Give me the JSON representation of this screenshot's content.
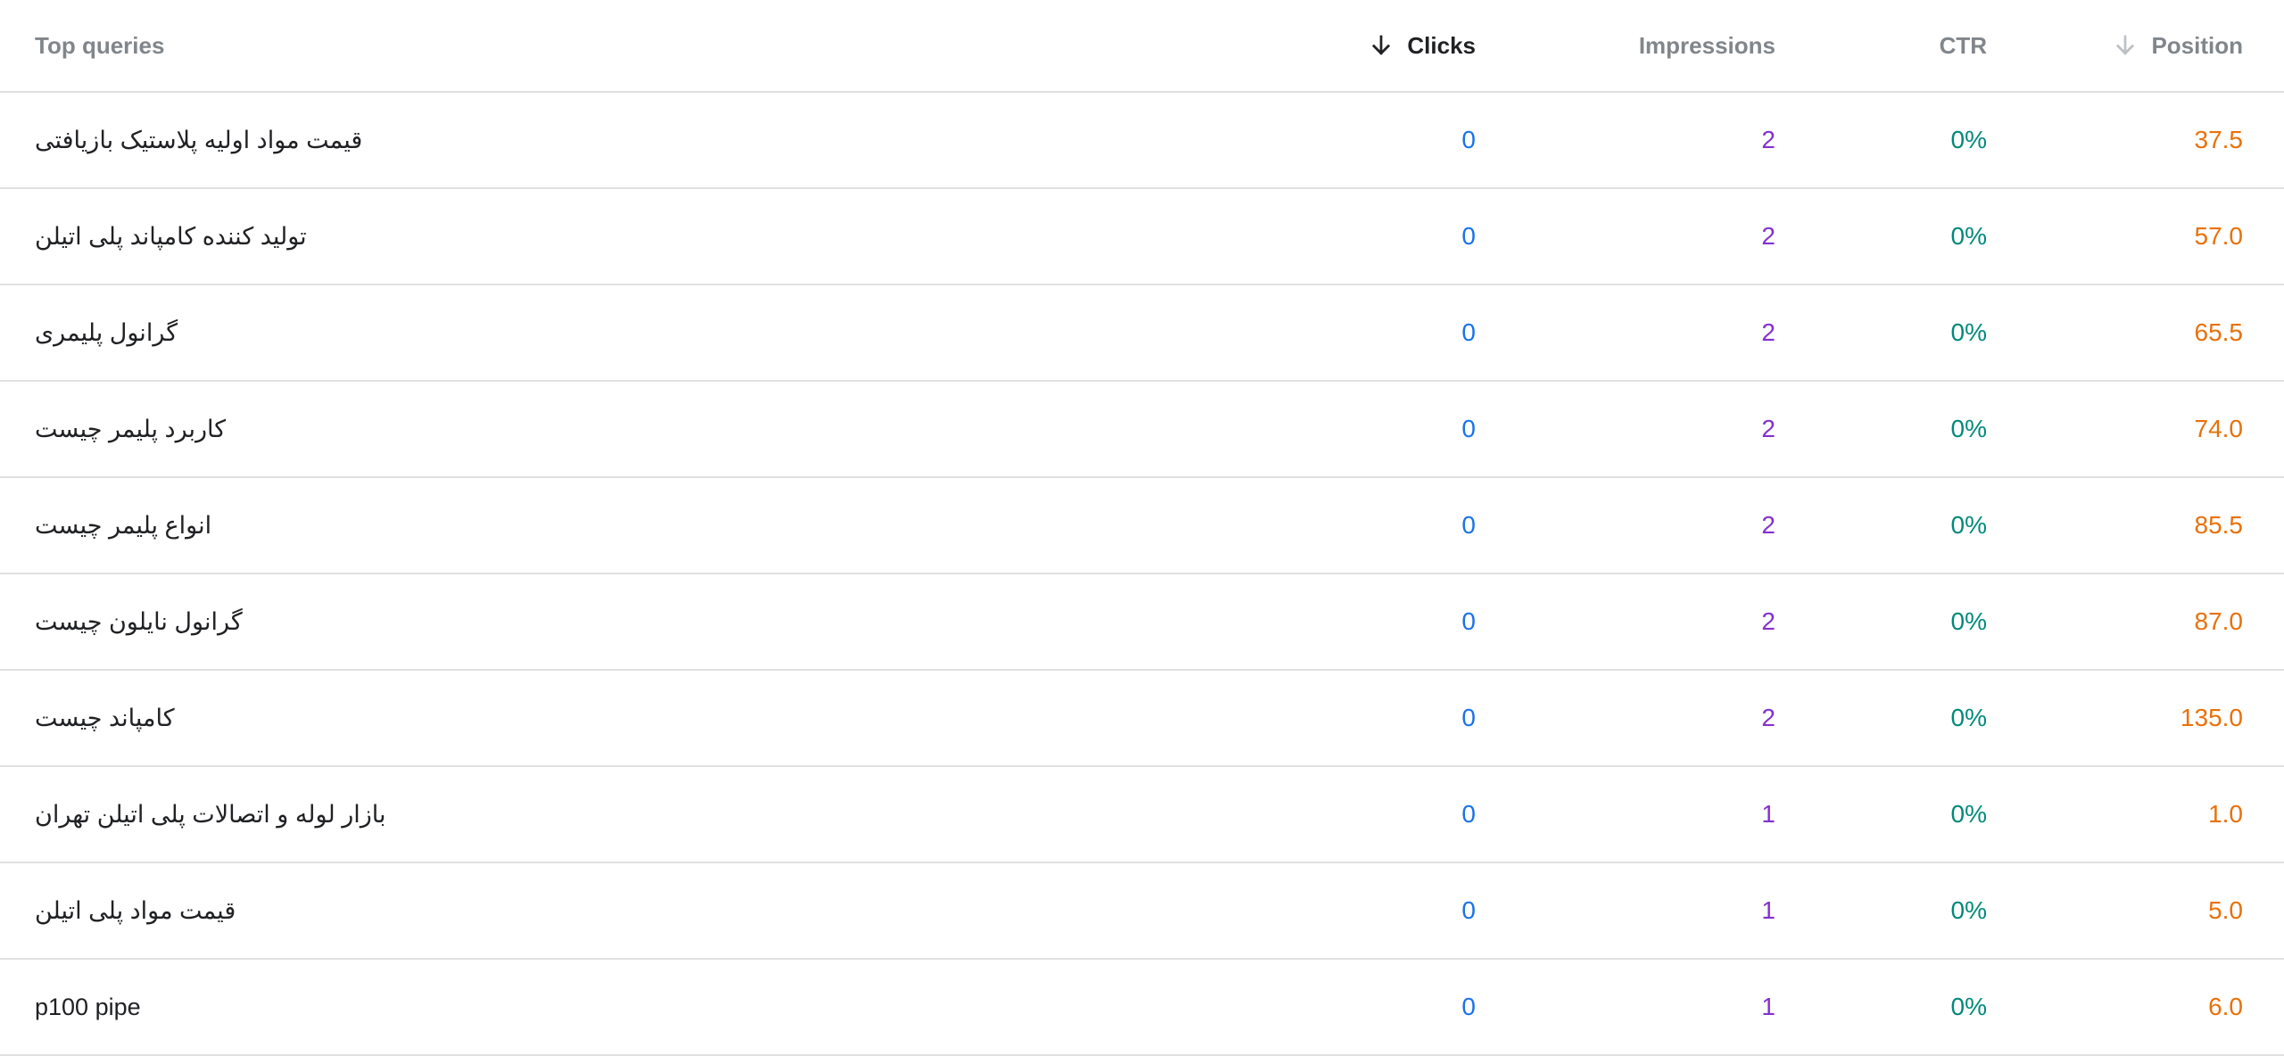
{
  "header": {
    "query_label": "Top queries",
    "clicks_label": "Clicks",
    "impressions_label": "Impressions",
    "ctr_label": "CTR",
    "position_label": "Position",
    "clicks_sort_icon": "arrow-down-icon",
    "position_sort_icon": "arrow-down-icon",
    "sorted_column": "clicks"
  },
  "colors": {
    "clicks": "#1a73e8",
    "impressions": "#8430ce",
    "ctr": "#00897b",
    "position": "#e8710a"
  },
  "rows": [
    {
      "query": "قیمت مواد اولیه پلاستیک بازیافتی",
      "clicks": "0",
      "impressions": "2",
      "ctr": "0%",
      "position": "37.5"
    },
    {
      "query": "تولید کننده کامپاند پلی اتیلن",
      "clicks": "0",
      "impressions": "2",
      "ctr": "0%",
      "position": "57.0"
    },
    {
      "query": "گرانول پلیمری",
      "clicks": "0",
      "impressions": "2",
      "ctr": "0%",
      "position": "65.5"
    },
    {
      "query": "کاربرد پلیمر چیست",
      "clicks": "0",
      "impressions": "2",
      "ctr": "0%",
      "position": "74.0"
    },
    {
      "query": "انواع پلیمر چیست",
      "clicks": "0",
      "impressions": "2",
      "ctr": "0%",
      "position": "85.5"
    },
    {
      "query": "گرانول نایلون چیست",
      "clicks": "0",
      "impressions": "2",
      "ctr": "0%",
      "position": "87.0"
    },
    {
      "query": "کامپاند چیست",
      "clicks": "0",
      "impressions": "2",
      "ctr": "0%",
      "position": "135.0"
    },
    {
      "query": "بازار لوله و اتصالات پلی اتیلن تهران",
      "clicks": "0",
      "impressions": "1",
      "ctr": "0%",
      "position": "1.0"
    },
    {
      "query": "قیمت مواد پلی اتیلن",
      "clicks": "0",
      "impressions": "1",
      "ctr": "0%",
      "position": "5.0"
    },
    {
      "query": "p100 pipe",
      "clicks": "0",
      "impressions": "1",
      "ctr": "0%",
      "position": "6.0"
    }
  ]
}
